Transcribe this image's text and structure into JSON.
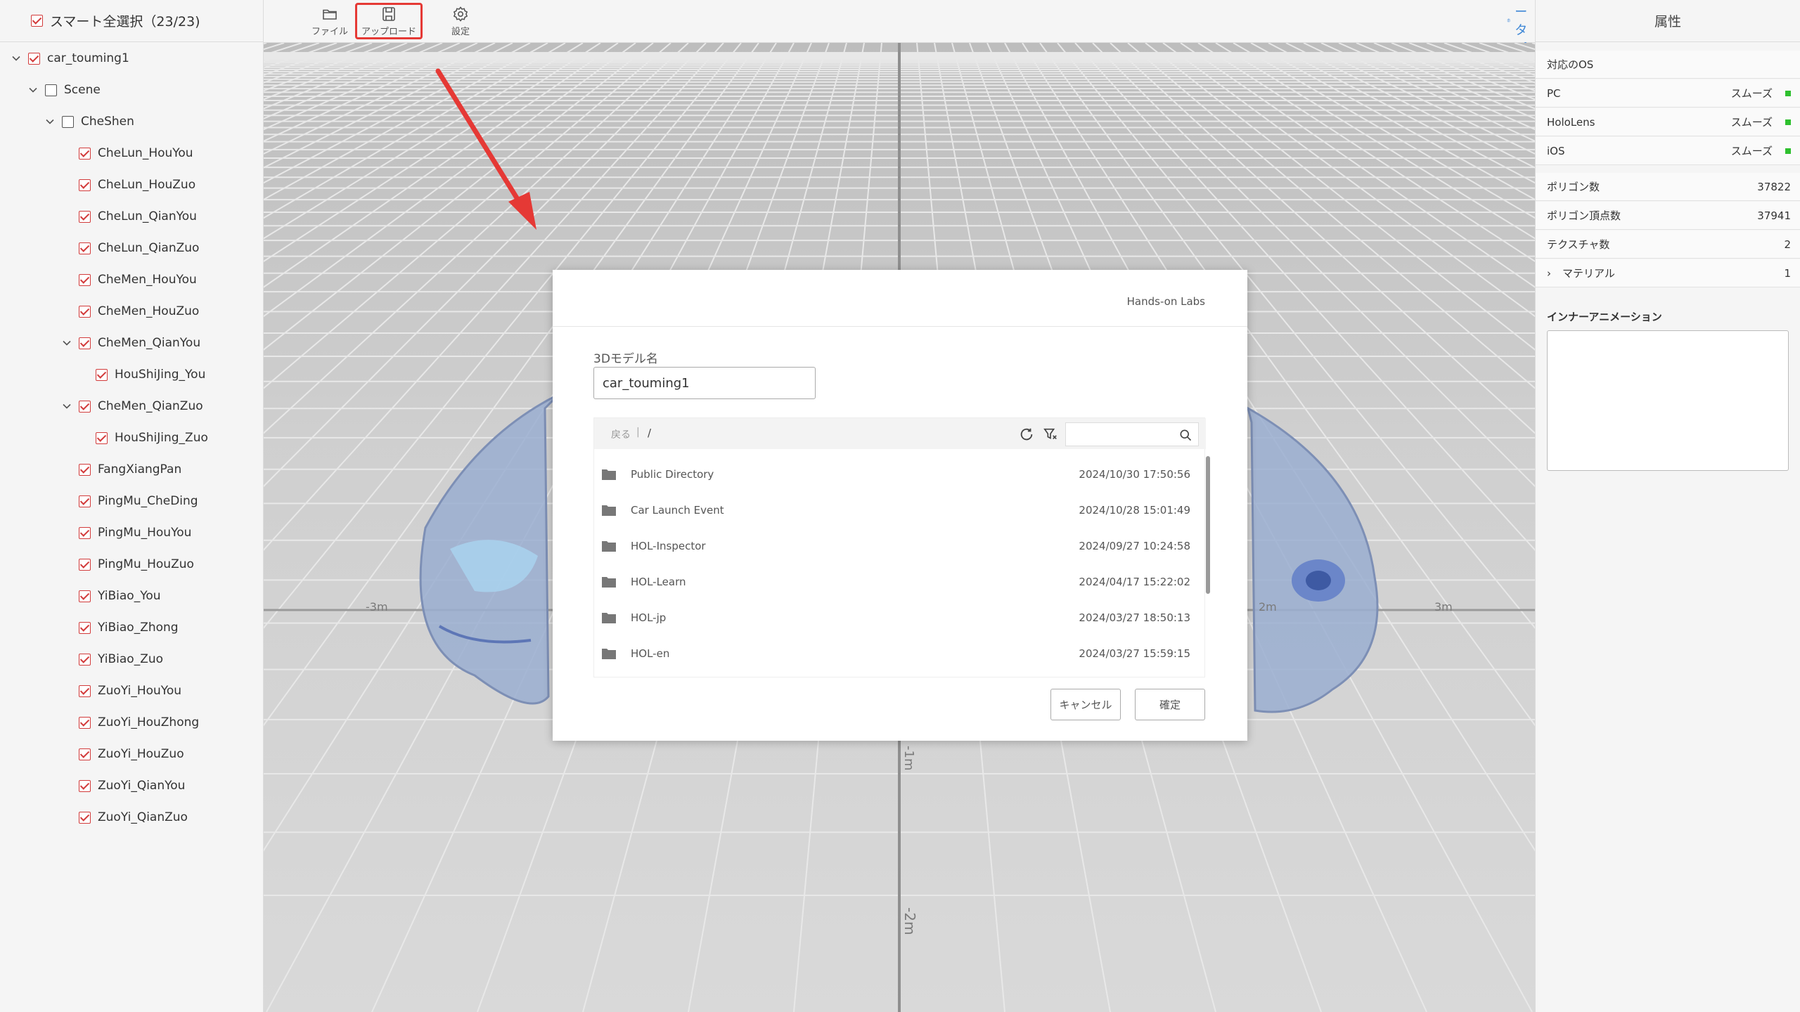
{
  "left_panel": {
    "select_all_label": "スマート全選択（23/23)",
    "tree": [
      {
        "label": "car_touming1",
        "checked": true,
        "caret": true
      },
      {
        "label": "Scene",
        "checked": false,
        "caret": true
      },
      {
        "label": "CheShen",
        "checked": false,
        "caret": true
      },
      {
        "label": "CheLun_HouYou",
        "checked": true,
        "caret": false
      },
      {
        "label": "CheLun_HouZuo",
        "checked": true,
        "caret": false
      },
      {
        "label": "CheLun_QianYou",
        "checked": true,
        "caret": false
      },
      {
        "label": "CheLun_QianZuo",
        "checked": true,
        "caret": false
      },
      {
        "label": "CheMen_HouYou",
        "checked": true,
        "caret": false
      },
      {
        "label": "CheMen_HouZuo",
        "checked": true,
        "caret": false
      },
      {
        "label": "CheMen_QianYou",
        "checked": true,
        "caret": true
      },
      {
        "label": "HouShiJing_You",
        "checked": true,
        "caret": false
      },
      {
        "label": "CheMen_QianZuo",
        "checked": true,
        "caret": true
      },
      {
        "label": "HouShiJing_Zuo",
        "checked": true,
        "caret": false
      },
      {
        "label": "FangXiangPan",
        "checked": true,
        "caret": false
      },
      {
        "label": "PingMu_CheDing",
        "checked": true,
        "caret": false
      },
      {
        "label": "PingMu_HouYou",
        "checked": true,
        "caret": false
      },
      {
        "label": "PingMu_HouZuo",
        "checked": true,
        "caret": false
      },
      {
        "label": "YiBiao_You",
        "checked": true,
        "caret": false
      },
      {
        "label": "YiBiao_Zhong",
        "checked": true,
        "caret": false
      },
      {
        "label": "YiBiao_Zuo",
        "checked": true,
        "caret": false
      },
      {
        "label": "ZuoYi_HouYou",
        "checked": true,
        "caret": false
      },
      {
        "label": "ZuoYi_HouZhong",
        "checked": true,
        "caret": false
      },
      {
        "label": "ZuoYi_HouZuo",
        "checked": true,
        "caret": false
      },
      {
        "label": "ZuoYi_QianYou",
        "checked": true,
        "caret": false
      },
      {
        "label": "ZuoYi_QianZuo",
        "checked": true,
        "caret": false
      }
    ]
  },
  "toolbar": {
    "file_label": "ファイル",
    "upload_label": "アップロード",
    "settings_label": "設定",
    "metadata_label": "メタデータパネル"
  },
  "viewport": {
    "axis_labels": [
      "-3m",
      "2m",
      "3m",
      "-1m",
      "-2m"
    ]
  },
  "right_panel": {
    "title": "属性",
    "os_header": "対応のOS",
    "os_rows": [
      {
        "name": "PC",
        "status": "スムーズ"
      },
      {
        "name": "HoloLens",
        "status": "スムーズ"
      },
      {
        "name": "iOS",
        "status": "スムーズ"
      }
    ],
    "stats": [
      {
        "name": "ポリゴン数",
        "value": "37822"
      },
      {
        "name": "ポリゴン頂点数",
        "value": "37941"
      },
      {
        "name": "テクスチャ数",
        "value": "2"
      },
      {
        "name": "マテリアル",
        "value": "1"
      }
    ],
    "animation_label": "インナーアニメーション",
    "status_color": "#2ec02e"
  },
  "dialog": {
    "brand": "Hands-on Labs",
    "model_name_label": "3Dモデル名",
    "model_name_value": "car_touming1",
    "back_label": "戻る",
    "path": "/",
    "folders": [
      {
        "name": "Public Directory",
        "date": "2024/10/30 17:50:56"
      },
      {
        "name": "Car Launch Event",
        "date": "2024/10/28 15:01:49"
      },
      {
        "name": "HOL-Inspector",
        "date": "2024/09/27 10:24:58"
      },
      {
        "name": "HOL-Learn",
        "date": "2024/04/17 15:22:02"
      },
      {
        "name": "HOL-jp",
        "date": "2024/03/27 18:50:13"
      },
      {
        "name": "HOL-en",
        "date": "2024/03/27 15:59:15"
      }
    ],
    "cancel_label": "キャンセル",
    "confirm_label": "確定"
  },
  "accent_color": "#3d86d6",
  "highlight_color": "#e53935"
}
